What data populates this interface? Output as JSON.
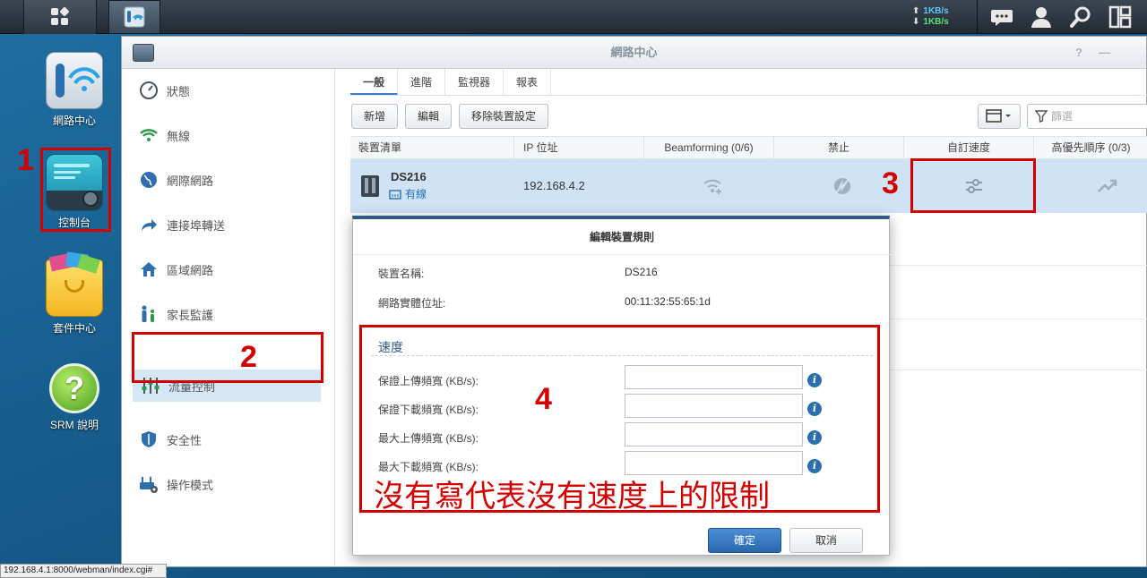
{
  "taskbar": {
    "speed_up": "1KB/s",
    "speed_down": "1KB/s",
    "icons": [
      "main-menu-icon",
      "network-center-icon",
      "chat-icon",
      "user-icon",
      "search-icon",
      "widgets-icon"
    ]
  },
  "desktop": {
    "icons": [
      {
        "label": "網路中心",
        "icon": "wifi-router-icon"
      },
      {
        "label": "控制台",
        "icon": "control-panel-icon"
      },
      {
        "label": "套件中心",
        "icon": "package-bag-icon"
      },
      {
        "label": "SRM 說明",
        "icon": "help-icon"
      }
    ]
  },
  "window": {
    "title": "網路中心",
    "controls": {
      "help": "?",
      "minimize": "—"
    }
  },
  "sidebar": {
    "items": [
      {
        "label": "狀態",
        "icon": "gauge-icon"
      },
      {
        "label": "無線",
        "icon": "wifi-icon"
      },
      {
        "label": "網際網路",
        "icon": "globe-icon"
      },
      {
        "label": "連接埠轉送",
        "icon": "forward-arrow-icon"
      },
      {
        "label": "區域網路",
        "icon": "home-network-icon"
      },
      {
        "label": "家長監護",
        "icon": "family-icon"
      },
      {
        "label": "流量控制",
        "icon": "sliders-icon"
      },
      {
        "label": "安全性",
        "icon": "shield-icon"
      },
      {
        "label": "操作模式",
        "icon": "router-mode-icon"
      }
    ]
  },
  "tabs": [
    "一般",
    "進階",
    "監視器",
    "報表"
  ],
  "toolbar": {
    "add": "新增",
    "edit": "編輯",
    "remove": "移除裝置設定",
    "filter_placeholder": "篩選"
  },
  "table": {
    "headers": [
      "裝置清單",
      "IP 位址",
      "Beamforming (0/6)",
      "禁止",
      "自訂速度",
      "高優先順序 (0/3)"
    ],
    "rows": [
      {
        "device": "DS216",
        "connection": "有線",
        "ip": "192.168.4.2"
      }
    ]
  },
  "dialog": {
    "title": "編輯裝置規則",
    "device_name_label": "裝置名稱:",
    "device_name_value": "DS216",
    "mac_label": "網路實體位址:",
    "mac_value": "00:11:32:55:65:1d",
    "speed_section": "速度",
    "fields": [
      {
        "label": "保證上傳頻寬 (KB/s):",
        "value": ""
      },
      {
        "label": "保證下載頻寬 (KB/s):",
        "value": ""
      },
      {
        "label": "最大上傳頻寬 (KB/s):",
        "value": ""
      },
      {
        "label": "最大下載頻寬 (KB/s):",
        "value": ""
      }
    ],
    "ok": "確定",
    "cancel": "取消"
  },
  "annotations": {
    "n1": "1",
    "n2": "2",
    "n3": "3",
    "n4": "4",
    "note": "沒有寫代表沒有速度上的限制",
    "color": "#d40000"
  },
  "statusbar": "192.168.4.1:8000/webman/index.cgi#"
}
